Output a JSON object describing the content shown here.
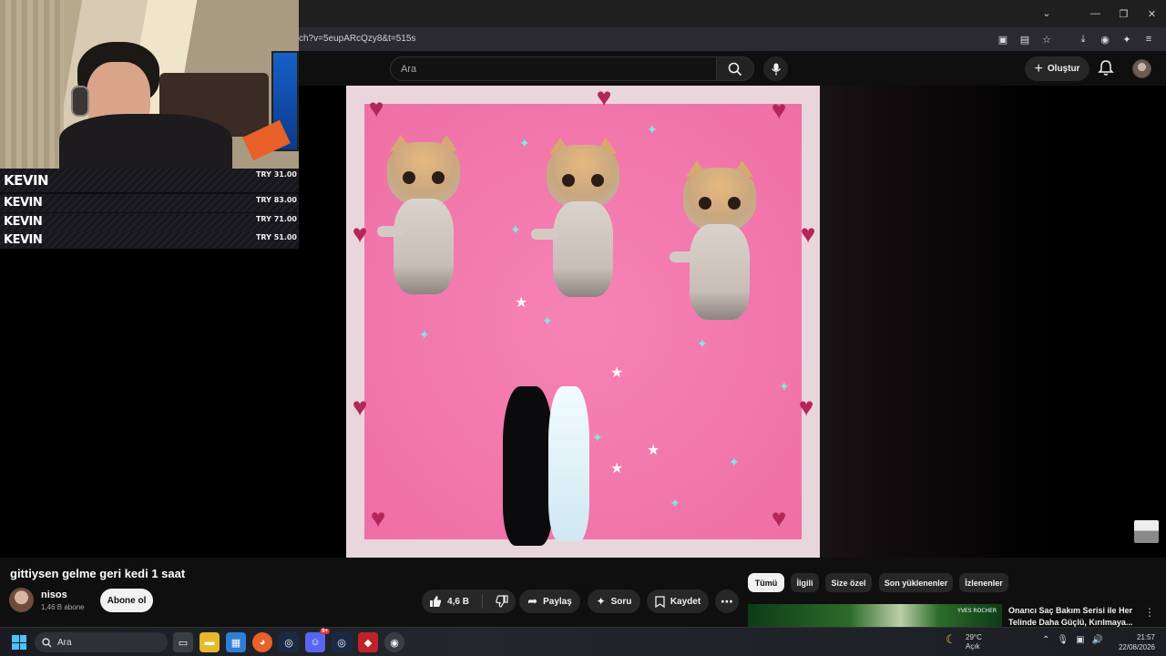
{
  "browser": {
    "url": "ch?v=5eupARcQzy8&t=515s",
    "window_controls": [
      "minimize",
      "restore",
      "close"
    ]
  },
  "header": {
    "search_placeholder": "Ara",
    "create_label": "Oluştur"
  },
  "overlay": {
    "donations": [
      {
        "name": "KEVIN",
        "amount": "TRY 31.00"
      },
      {
        "name": "KEVIN",
        "amount": "TRY 83.00"
      },
      {
        "name": "KEVIN",
        "amount": "TRY 71.00"
      },
      {
        "name": "KEVIN",
        "amount": "TRY 51.00"
      }
    ]
  },
  "video": {
    "title": "gittiysen gelme geri kedi 1 saat",
    "channel": "nisos",
    "subscribers": "1,46 B abone",
    "subscribe_label": "Abone ol",
    "likes": "4,6 B",
    "share_label": "Paylaş",
    "ask_label": "Soru",
    "save_label": "Kaydet"
  },
  "chips": [
    "Tümü",
    "İlgili",
    "Size özel",
    "Son yüklenenler",
    "İzlenenler"
  ],
  "recommendation": {
    "title": "Onarıcı Saç Bakım Serisi ile Her Telinde Daha Güçlü, Kırılmaya...",
    "brand": "YVES ROCHER"
  },
  "taskbar": {
    "search_label": "Ara",
    "weather_temp": "29°C",
    "weather_desc": "Açık",
    "time": "21:57",
    "date": "22/08/2026",
    "discord_badge": "9+"
  },
  "colors": {
    "accent_pink": "#f07fae",
    "youtube_bg": "#0f0f0f",
    "chip_active": "#f1f1f1"
  }
}
